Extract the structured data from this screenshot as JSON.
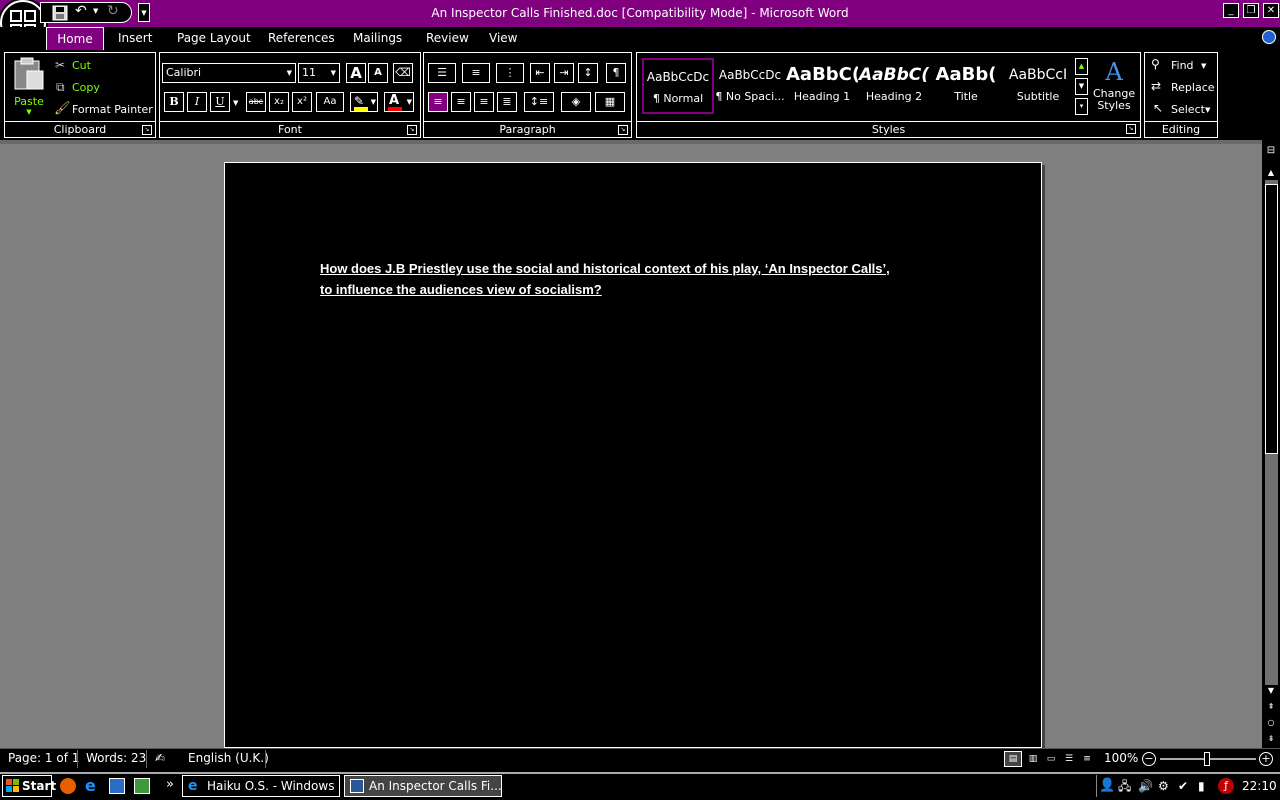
{
  "window": {
    "title": "An Inspector Calls Finished.doc [Compatibility Mode] - Microsoft Word",
    "minimize": "_",
    "restore": "❐",
    "close": "✕"
  },
  "tabs": [
    "Home",
    "Insert",
    "Page Layout",
    "References",
    "Mailings",
    "Review",
    "View"
  ],
  "clipboard": {
    "paste": "Paste",
    "cut": "Cut",
    "copy": "Copy",
    "format_painter": "Format Painter",
    "label": "Clipboard"
  },
  "font": {
    "family": "Calibri",
    "size": "11",
    "label": "Font",
    "grow": "A",
    "shrink": "A",
    "bold": "B",
    "italic": "I",
    "underline": "U",
    "strike": "abc",
    "sub": "x₂",
    "sup": "x²",
    "case": "Aa",
    "color": "A"
  },
  "paragraph": {
    "label": "Paragraph",
    "pilcrow": "¶"
  },
  "styles": {
    "label": "Styles",
    "tiles": [
      {
        "preview": "AaBbCcDc",
        "name": "¶ Normal"
      },
      {
        "preview": "AaBbCcDc",
        "name": "¶ No Spaci..."
      },
      {
        "preview": "AaBbC(",
        "name": "Heading 1"
      },
      {
        "preview": "AaBbC(",
        "name": "Heading 2"
      },
      {
        "preview": "AaBb(",
        "name": "Title"
      },
      {
        "preview": "AaBbCcI",
        "name": "Subtitle"
      }
    ],
    "change_styles": "Change Styles"
  },
  "editing": {
    "find": "Find",
    "replace": "Replace",
    "select": "Select",
    "label": "Editing"
  },
  "document": {
    "heading": "How does J.B Priestley use the social and historical context of his play, ‘An Inspector Calls’, to influence the audiences view of socialism?"
  },
  "status": {
    "page": "Page: 1 of 1",
    "words": "Words: 23",
    "language": "English (U.K.)",
    "zoom": "100%"
  },
  "taskbar": {
    "start": "Start",
    "windows": [
      "Haiku O.S. - Windows Int...",
      "An Inspector Calls Fi..."
    ],
    "time": "22:10",
    "overflow": "»"
  },
  "colors": {
    "accent": "#800080",
    "highlight": "#ffff00",
    "font_color": "#ff0000",
    "lime": "#7fff00"
  }
}
